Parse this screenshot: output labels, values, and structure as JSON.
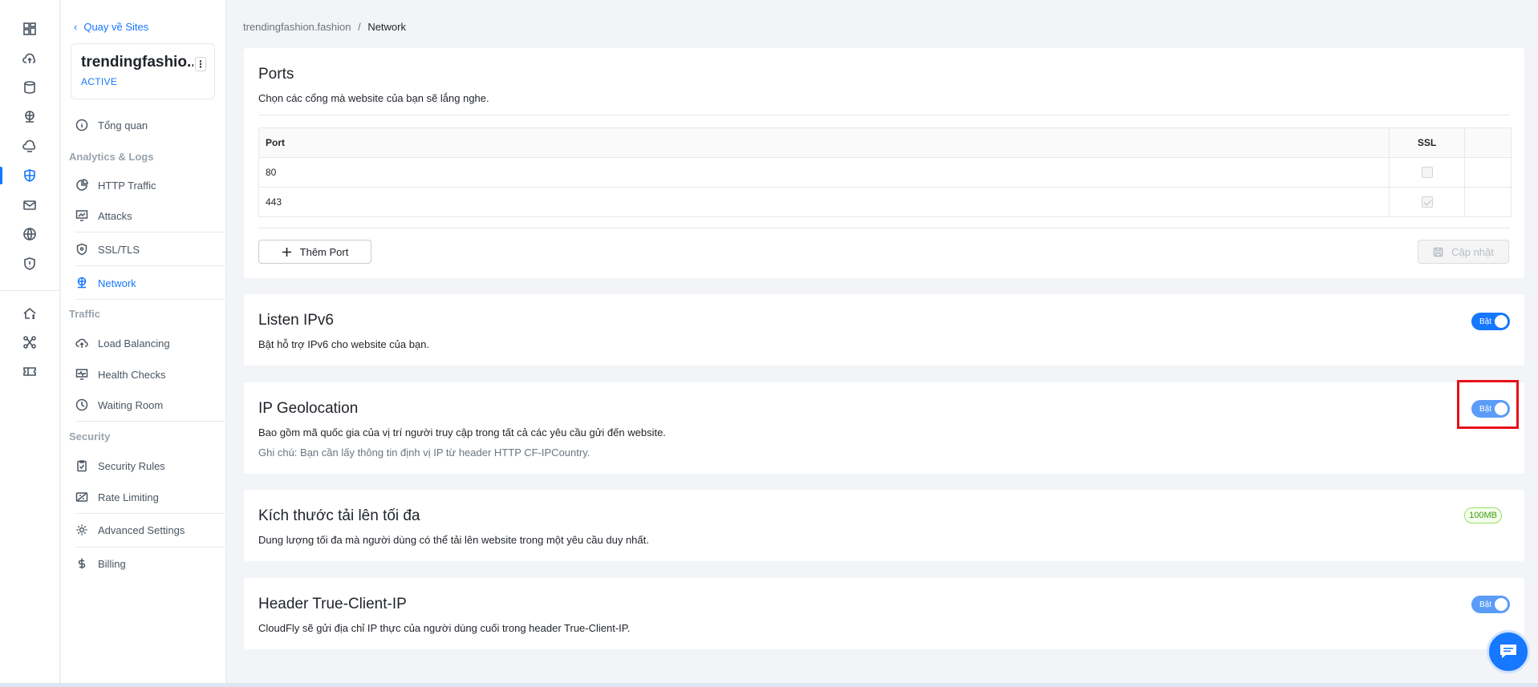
{
  "sidebar": {
    "back_label": "Quay về Sites",
    "site_name": "trendingfashio...",
    "site_status": "ACTIVE",
    "overview": "Tổng quan",
    "group_analytics": "Analytics & Logs",
    "http_traffic": "HTTP Traffic",
    "attacks": "Attacks",
    "ssl_tls": "SSL/TLS",
    "network": "Network",
    "group_traffic": "Traffic",
    "load_balancing": "Load Balancing",
    "health_checks": "Health Checks",
    "waiting_room": "Waiting Room",
    "group_security": "Security",
    "security_rules": "Security Rules",
    "rate_limiting": "Rate Limiting",
    "advanced_settings": "Advanced Settings",
    "billing": "Billing"
  },
  "breadcrumb": {
    "site": "trendingfashion.fashion",
    "separator": "/",
    "current": "Network"
  },
  "ports": {
    "title": "Ports",
    "description": "Chọn các cổng mà website của bạn sẽ lắng nghe.",
    "col_port": "Port",
    "col_ssl": "SSL",
    "rows": [
      {
        "port": "80",
        "ssl": false
      },
      {
        "port": "443",
        "ssl": true
      }
    ],
    "add_label": "Thêm Port",
    "update_label": "Cập nhật"
  },
  "ipv6": {
    "title": "Listen IPv6",
    "description": "Bật hỗ trợ IPv6 cho website của bạn.",
    "toggle_label": "Bật",
    "enabled": true
  },
  "geolocation": {
    "title": "IP Geolocation",
    "description": "Bao gồm mã quốc gia của vị trí người truy cập trong tất cả các yêu cầu gửi đến website.",
    "note": "Ghi chú: Bạn cần lấy thông tin định vị IP từ header HTTP CF-IPCountry.",
    "toggle_label": "Bật",
    "enabled": true
  },
  "upload": {
    "title": "Kích thước tải lên tối đa",
    "description": "Dung lượng tối đa mà người dùng có thể tải lên website trong một yêu cầu duy nhất.",
    "value": "100MB"
  },
  "true_client_ip": {
    "title": "Header True-Client-IP",
    "description": "CloudFly sẽ gửi địa chỉ IP thực của người dùng cuối trong header True-Client-IP.",
    "toggle_label": "Bật",
    "enabled": true
  },
  "colors": {
    "accent": "#1677ff",
    "highlight": "#e8101a"
  },
  "icons": {
    "rail": [
      "dashboard-icon",
      "cloud-upload-icon",
      "database-icon",
      "network-icon",
      "cloud-icon",
      "shield-globe-icon",
      "mail-icon",
      "www-icon",
      "shield-icon",
      "home-dollar-icon",
      "nodes-icon",
      "ticket-icon"
    ],
    "chat": "chat-icon"
  }
}
